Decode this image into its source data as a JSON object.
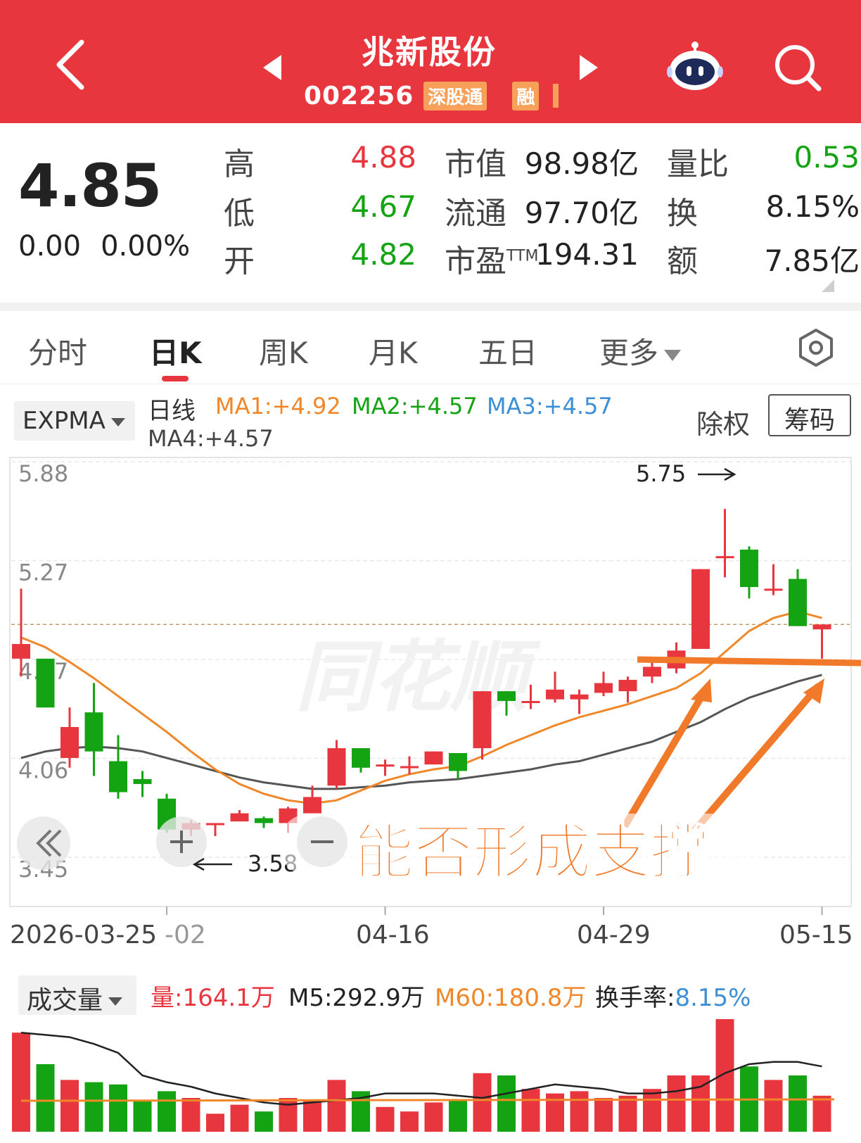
{
  "header": {
    "stock_name": "兆新股份",
    "stock_code": "002256",
    "tags": [
      "深股通",
      "融"
    ]
  },
  "quote": {
    "price": "4.85",
    "change": "0.00",
    "change_pct": "0.00%",
    "high_label": "高",
    "high": "4.88",
    "low_label": "低",
    "low": "4.67",
    "open_label": "开",
    "open": "4.82",
    "mktcap_label": "市值",
    "mktcap": "98.98亿",
    "float_label": "流通",
    "float": "97.70亿",
    "pe_label": "市盈",
    "pe_sup": "TTM",
    "pe": "194.31",
    "volratio_label": "量比",
    "volratio": "0.53",
    "turnover_label": "换",
    "turnover": "8.15%",
    "amount_label": "额",
    "amount": "7.85亿"
  },
  "tabs": [
    {
      "label": "分时"
    },
    {
      "label": "日K"
    },
    {
      "label": "周K"
    },
    {
      "label": "月K"
    },
    {
      "label": "五日"
    },
    {
      "label": "更多"
    }
  ],
  "indicator": {
    "selected": "EXPMA",
    "line_label": "日线",
    "ma1": "MA1:+4.92",
    "ma2": "MA2:+4.57",
    "ma3": "MA3:+4.57",
    "ma4": "MA4:+4.57",
    "chuquan": "除权",
    "chouma": "筹码"
  },
  "colors": {
    "up": "#e8363e",
    "down": "#13a313",
    "ma1": "#f0882a",
    "ma2": "#13a313",
    "ma3": "#3d8fd6",
    "avg_line": "#555555",
    "annotation": "#f07a2a"
  },
  "chart_data": {
    "type": "candlestick",
    "y_ticks": [
      "5.88",
      "5.27",
      "4.67",
      "4.06",
      "3.45"
    ],
    "ylim": [
      3.45,
      5.88
    ],
    "dates": [
      "2026-03-25",
      "-02",
      "04-16",
      "04-29",
      "05-15"
    ],
    "high_annotation": "5.75",
    "low_annotation": "3.58",
    "annotation_text": "能否形成支撑",
    "candles": [
      {
        "o": 4.67,
        "c": 4.76,
        "h": 5.1,
        "l": 4.56
      },
      {
        "o": 4.67,
        "c": 4.37,
        "h": 4.67,
        "l": 4.37
      },
      {
        "o": 4.06,
        "c": 4.25,
        "h": 4.37,
        "l": 4.0
      },
      {
        "o": 4.34,
        "c": 4.1,
        "h": 4.52,
        "l": 3.95
      },
      {
        "o": 4.04,
        "c": 3.85,
        "h": 4.2,
        "l": 3.81
      },
      {
        "o": 3.93,
        "c": 3.9,
        "h": 3.98,
        "l": 3.82
      },
      {
        "o": 3.81,
        "c": 3.62,
        "h": 3.84,
        "l": 3.6
      },
      {
        "o": 3.62,
        "c": 3.66,
        "h": 3.68,
        "l": 3.58
      },
      {
        "o": 3.65,
        "c": 3.66,
        "h": 3.66,
        "l": 3.58
      },
      {
        "o": 3.67,
        "c": 3.72,
        "h": 3.74,
        "l": 3.67
      },
      {
        "o": 3.69,
        "c": 3.66,
        "h": 3.7,
        "l": 3.63
      },
      {
        "o": 3.66,
        "c": 3.75,
        "h": 3.76,
        "l": 3.6
      },
      {
        "o": 3.72,
        "c": 3.82,
        "h": 3.89,
        "l": 3.72
      },
      {
        "o": 3.89,
        "c": 4.12,
        "h": 4.17,
        "l": 3.87
      },
      {
        "o": 4.12,
        "c": 4.0,
        "h": 4.12,
        "l": 3.97
      },
      {
        "o": 4.02,
        "c": 4.02,
        "h": 4.05,
        "l": 3.95
      },
      {
        "o": 4.01,
        "c": 4.01,
        "h": 4.07,
        "l": 3.96
      },
      {
        "o": 4.02,
        "c": 4.1,
        "h": 4.1,
        "l": 4.02
      },
      {
        "o": 4.09,
        "c": 3.98,
        "h": 4.09,
        "l": 3.93
      },
      {
        "o": 4.12,
        "c": 4.47,
        "h": 4.47,
        "l": 4.05
      },
      {
        "o": 4.47,
        "c": 4.41,
        "h": 4.47,
        "l": 4.32
      },
      {
        "o": 4.41,
        "c": 4.41,
        "h": 4.51,
        "l": 4.36
      },
      {
        "o": 4.42,
        "c": 4.48,
        "h": 4.59,
        "l": 4.4
      },
      {
        "o": 4.42,
        "c": 4.45,
        "h": 4.48,
        "l": 4.33
      },
      {
        "o": 4.46,
        "c": 4.52,
        "h": 4.59,
        "l": 4.44
      },
      {
        "o": 4.47,
        "c": 4.54,
        "h": 4.56,
        "l": 4.4
      },
      {
        "o": 4.56,
        "c": 4.62,
        "h": 4.67,
        "l": 4.52
      },
      {
        "o": 4.61,
        "c": 4.72,
        "h": 4.77,
        "l": 4.58
      },
      {
        "o": 4.73,
        "c": 5.22,
        "h": 5.22,
        "l": 4.73
      },
      {
        "o": 5.3,
        "c": 5.3,
        "h": 5.59,
        "l": 5.17
      },
      {
        "o": 5.34,
        "c": 5.11,
        "h": 5.36,
        "l": 5.04
      },
      {
        "o": 5.1,
        "c": 5.1,
        "h": 5.25,
        "l": 5.06
      },
      {
        "o": 5.16,
        "c": 4.87,
        "h": 5.22,
        "l": 4.87
      },
      {
        "o": 4.85,
        "c": 4.88,
        "h": 4.88,
        "l": 4.67
      }
    ],
    "ma_short": [
      4.8,
      4.74,
      4.65,
      4.55,
      4.44,
      4.33,
      4.22,
      4.1,
      3.99,
      3.9,
      3.84,
      3.8,
      3.78,
      3.8,
      3.86,
      3.92,
      3.96,
      3.99,
      4.01,
      4.07,
      4.14,
      4.2,
      4.26,
      4.31,
      4.35,
      4.39,
      4.44,
      4.49,
      4.58,
      4.71,
      4.84,
      4.92,
      4.96,
      4.92
    ],
    "ma_long": [
      4.06,
      4.1,
      4.12,
      4.13,
      4.12,
      4.1,
      4.06,
      4.02,
      3.98,
      3.94,
      3.91,
      3.89,
      3.87,
      3.87,
      3.88,
      3.89,
      3.91,
      3.92,
      3.93,
      3.95,
      3.97,
      3.99,
      4.02,
      4.04,
      4.08,
      4.12,
      4.16,
      4.22,
      4.28,
      4.36,
      4.43,
      4.48,
      4.53,
      4.57
    ]
  },
  "volume": {
    "selected": "成交量",
    "vol": "量:164.1万",
    "m5": "M5:292.9万",
    "m60": "M60:180.8万",
    "turnover_label": "换手率:",
    "turnover_val": "8.15%"
  }
}
